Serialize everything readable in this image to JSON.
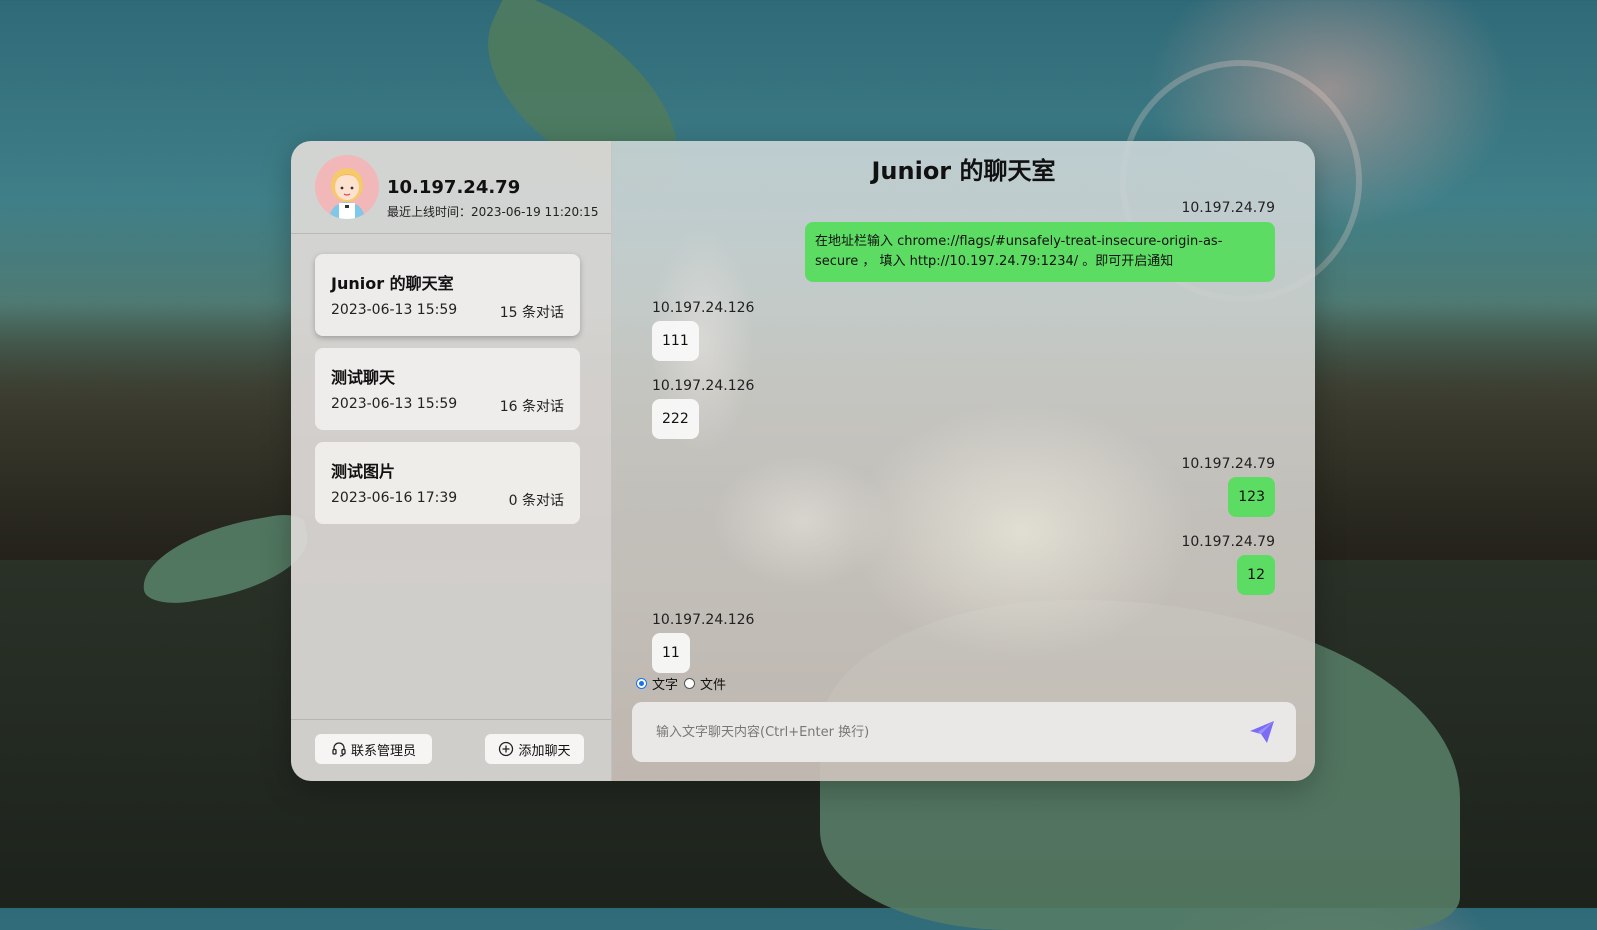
{
  "user": {
    "ip": "10.197.24.79",
    "last_online": "最近上线时间：2023-06-19 11:20:15"
  },
  "chats": [
    {
      "name": "Junior 的聊天室",
      "date": "2023-06-13 15:59",
      "count": "15 条对话",
      "active": true
    },
    {
      "name": "测试聊天",
      "date": "2023-06-13 15:59",
      "count": "16 条对话",
      "active": false
    },
    {
      "name": "测试图片",
      "date": "2023-06-16 17:39",
      "count": "0 条对话",
      "active": false
    }
  ],
  "footer": {
    "contact_admin": "联系管理员",
    "add_chat": "添加聊天"
  },
  "room": {
    "title": "Junior 的聊天室"
  },
  "messages": [
    {
      "sender": "10.197.24.79",
      "text": "在地址栏输入 chrome://flags/#unsafely-treat-insecure-origin-as-secure ， 填入 http://10.197.24.79:1234/ 。即可开启通知",
      "mine": true
    },
    {
      "sender": "10.197.24.126",
      "text": "111",
      "mine": false
    },
    {
      "sender": "10.197.24.126",
      "text": "222",
      "mine": false
    },
    {
      "sender": "10.197.24.79",
      "text": "123",
      "mine": true
    },
    {
      "sender": "10.197.24.79",
      "text": "12",
      "mine": true
    },
    {
      "sender": "10.197.24.126",
      "text": "11",
      "mine": false
    }
  ],
  "composer": {
    "type_text": "文字",
    "type_file": "文件",
    "selected_type": "text",
    "placeholder": "输入文字聊天内容(Ctrl+Enter 换行)"
  },
  "colors": {
    "mine_bubble": "#5ddc63",
    "theirs_bubble": "#fafafa",
    "send_icon": "#7b6cf6",
    "avatar_bg": "#f2b7b8"
  }
}
